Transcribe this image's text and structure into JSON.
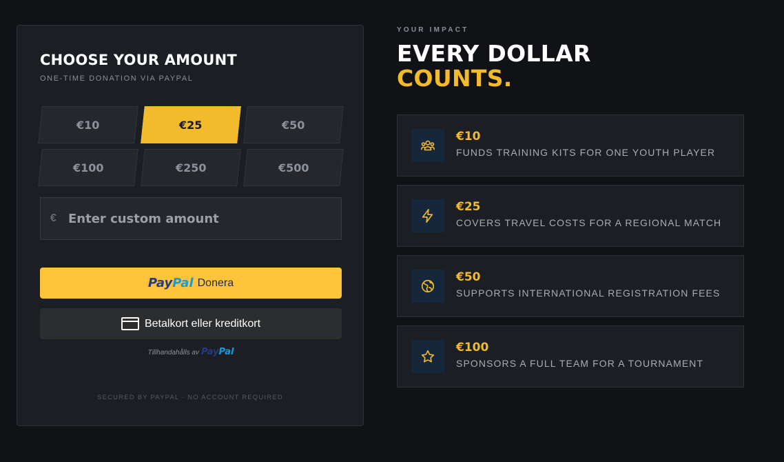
{
  "donation": {
    "title": "CHOOSE YOUR AMOUNT",
    "subtitle": "ONE-TIME DONATION VIA PAYPAL",
    "amounts": [
      {
        "label": "€10",
        "selected": false
      },
      {
        "label": "€25",
        "selected": true
      },
      {
        "label": "€50",
        "selected": false
      },
      {
        "label": "€100",
        "selected": false
      },
      {
        "label": "€250",
        "selected": false
      },
      {
        "label": "€500",
        "selected": false
      }
    ],
    "custom": {
      "currency_symbol": "€",
      "placeholder": "Enter custom amount",
      "value": ""
    },
    "paypal_button": {
      "logo_part1": "Pay",
      "logo_part2": "Pal",
      "label": "Donera"
    },
    "card_button": {
      "label": "Betalkort eller kreditkort",
      "icon": "credit-card-icon"
    },
    "powered_by": {
      "text": "Tillhandahålls av",
      "logo_part1": "Pay",
      "logo_part2": "Pal"
    },
    "footer_note": "SECURED BY PAYPAL · NO ACCOUNT REQUIRED"
  },
  "impact": {
    "eyebrow": "YOUR IMPACT",
    "heading_line1": "EVERY DOLLAR",
    "heading_line2": "COUNTS.",
    "items": [
      {
        "amount": "€10",
        "description": "FUNDS TRAINING KITS FOR ONE YOUTH PLAYER",
        "icon": "users-icon"
      },
      {
        "amount": "€25",
        "description": "COVERS TRAVEL COSTS FOR A REGIONAL MATCH",
        "icon": "lightning-icon"
      },
      {
        "amount": "€50",
        "description": "SUPPORTS INTERNATIONAL REGISTRATION FEES",
        "icon": "globe-icon"
      },
      {
        "amount": "€100",
        "description": "SPONSORS A FULL TEAM FOR A TOURNAMENT",
        "icon": "star-icon"
      }
    ]
  },
  "colors": {
    "background": "#101216",
    "card": "#1b1e23",
    "accent": "#f2bb2b",
    "paypal_yellow": "#ffc439",
    "icon_bg": "#16263b"
  }
}
